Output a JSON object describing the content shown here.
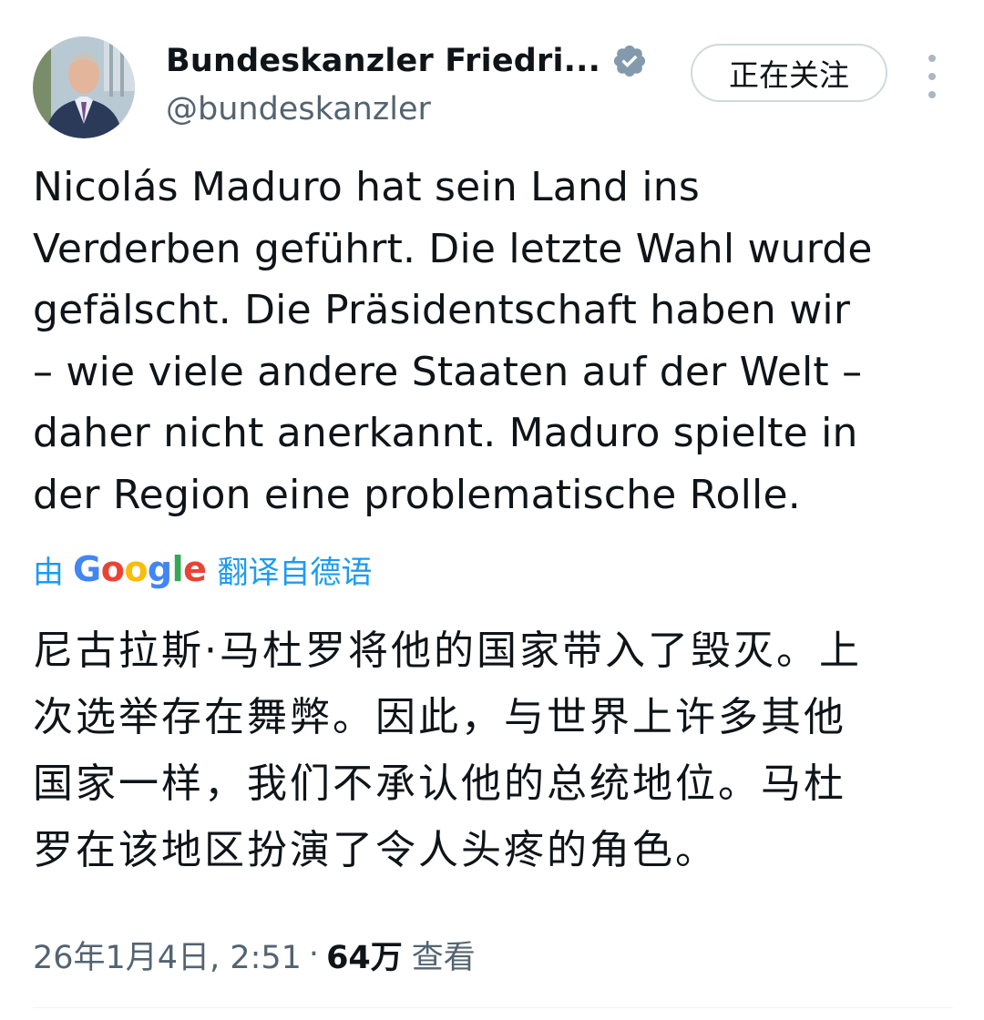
{
  "author": {
    "display_name": "Bundeskanzler Friedri...",
    "handle": "@bundeskanzler",
    "verified": true,
    "avatar_icon": "avatar-photo"
  },
  "actions": {
    "follow_label": "正在关注",
    "more_icon": "more-vertical-icon"
  },
  "tweet": {
    "text": "Nicolás Maduro hat sein Land ins\nVerderben geführt. Die letzte Wahl wurde\ngefälscht. Die Präsidentschaft haben wir\n– wie viele andere Staaten auf der Welt –\ndaher nicht anerkannt. Maduro spielte in\nder Region eine problematische Rolle.",
    "translation_prefix": "由",
    "translation_provider": "Google",
    "translation_suffix": "翻译自德语",
    "translated_text": "尼古拉斯·马杜罗将他的国家带入了毁灭。上\n次选举存在舞弊。因此，与世界上许多其他\n国家一样，我们不承认他的总统地位。马杜\n罗在该地区扮演了令人头疼的角色。"
  },
  "meta": {
    "timestamp": "26年1月4日, 2:51",
    "separator": "·",
    "views_count": "64万",
    "views_label": "查看"
  },
  "colors": {
    "text": "#0f1419",
    "secondary": "#536471",
    "link": "#1d9bf0",
    "verified_badge": "#829aab",
    "border": "#cfd9de"
  }
}
